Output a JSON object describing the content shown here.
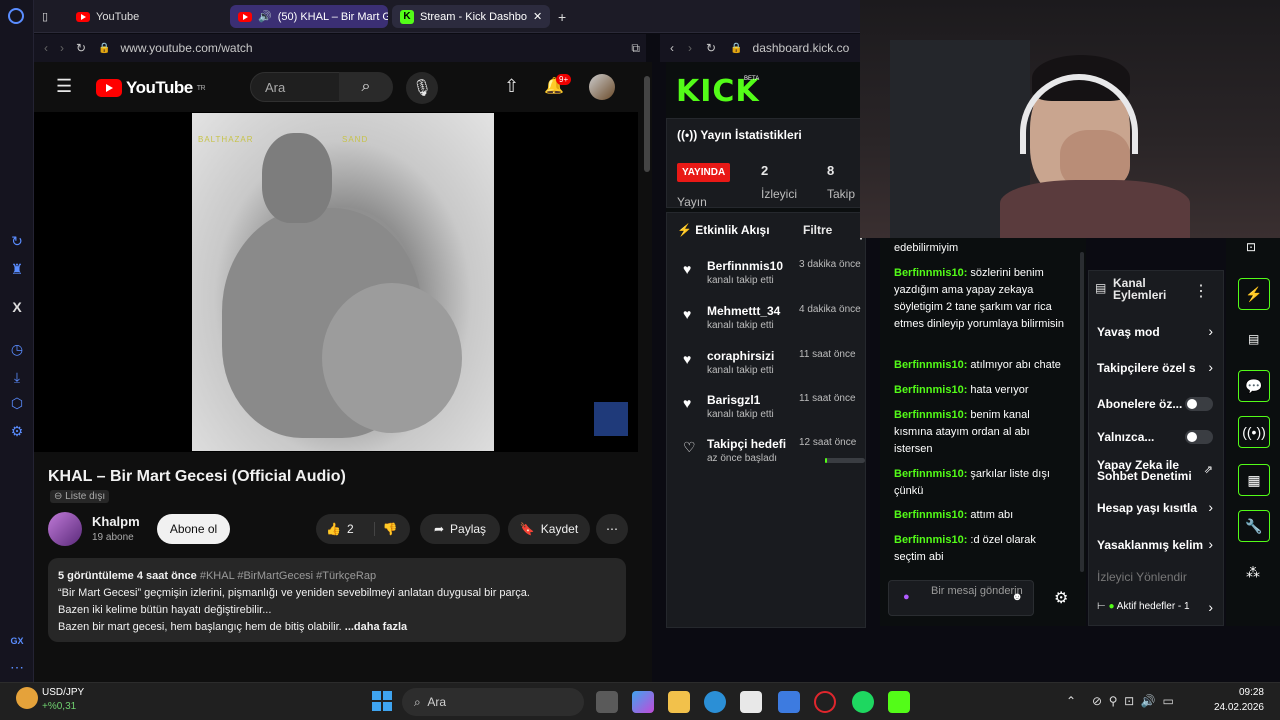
{
  "tabs": [
    {
      "label": "YouTube"
    },
    {
      "label": "(50) KHAL – Bir Mart G"
    },
    {
      "label": "Stream - Kick Dashbo"
    }
  ],
  "address_left": {
    "url": "www.youtube.com/watch"
  },
  "address_right": {
    "url": "dashboard.kick.co"
  },
  "youtube": {
    "logo": "YouTube",
    "region": "TR",
    "search_placeholder": "Ara",
    "notif_count": "9+",
    "video_overlay_left": "BALTHAZAR",
    "video_overlay_right": "SAND",
    "title": "KHAL – Bir Mart Gecesi (Official Audio)",
    "unlisted": "Liste dışı",
    "channel_name": "Khalpm",
    "channel_subs": "19 abone",
    "subscribe": "Abone ol",
    "likes": "2",
    "share": "Paylaş",
    "save": "Kaydet",
    "desc_meta": "5 görüntüleme  4 saat önce",
    "desc_tags": "#KHAL #BirMartGecesi #TürkçeRap",
    "desc_line1": "“Bir Mart Gecesi” geçmişin izlerini, pişmanlığı ve yeniden sevebilmeyi anlatan duygusal bir parça.",
    "desc_line2": "Bazen iki kelime bütün hayatı değiştirebilir...",
    "desc_line3": "Bazen bir mart gecesi, hem başlangıç hem de bitiş olabilir.",
    "desc_more": "...daha fazla"
  },
  "kick": {
    "logo": "KICK",
    "beta": "BETA",
    "stats_title": "Yayın İstatistikleri",
    "live_badge": "YAYINDA",
    "stat_viewers_value": "2",
    "stat_viewers_label": "İzleyici",
    "stat_followers_value": "8",
    "stat_followers_label": "Takip",
    "stat_stream_label": "Yayın",
    "feed_title": "Etkinlik Akışı",
    "feed_filter": "Filtre",
    "feed": [
      {
        "name": "Berfinnmis10",
        "sub": "kanalı takip etti",
        "time": "3 dakika önce"
      },
      {
        "name": "Mehmettt_34",
        "sub": "kanalı takip etti",
        "time": "4 dakika önce"
      },
      {
        "name": "coraphirsizi",
        "sub": "kanalı takip etti",
        "time": "11 saat önce"
      },
      {
        "name": "Barisgzl1",
        "sub": "kanalı takip etti",
        "time": "11 saat önce"
      },
      {
        "name": "Takipçi hedefi",
        "sub": "az önce başladı",
        "time": "12 saat önce"
      }
    ],
    "goal_progress": 0.05
  },
  "chat": {
    "messages": [
      {
        "user": "",
        "text": "edebilirmiyim"
      },
      {
        "user": "Berfinnmis10:",
        "text": " sözlerini benim yazdığım ama yapay zekaya söyletigim 2 tane şarkım var rica etmes dinleyip yorumlaya bilirmisin"
      },
      {
        "user": "Berfinnmis10:",
        "text": " atılmıyor abı chate"
      },
      {
        "user": "Berfinnmis10:",
        "text": " hata verıyor"
      },
      {
        "user": "Berfinnmis10:",
        "text": " benim kanal kısmına atayım ordan al abı istersen"
      },
      {
        "user": "Berfinnmis10:",
        "text": " şarkılar liste dışı çünkü"
      },
      {
        "user": "Berfinnmis10:",
        "text": " attım abı"
      },
      {
        "user": "Berfinnmis10:",
        "text": " :d özel olarak seçtim abi"
      }
    ],
    "input_placeholder": "Bir mesaj gönderin"
  },
  "channel_actions": {
    "title": "Kanal Eylemleri",
    "items": [
      {
        "label": "Yavaş mod",
        "kind": "chevron"
      },
      {
        "label": "Takipçilere özel s",
        "kind": "chevron"
      },
      {
        "label": "Abonelere öz...",
        "kind": "toggle"
      },
      {
        "label": "Yalnızca...",
        "kind": "toggle"
      },
      {
        "label": "Yapay Zeka ile Sohbet Denetimi",
        "kind": "external"
      },
      {
        "label": "Hesap yaşı kısıtla",
        "kind": "chevron"
      },
      {
        "label": "Yasaklanmış kelim",
        "kind": "chevron"
      },
      {
        "label": "İzleyici Yönlendir",
        "kind": "disabled"
      },
      {
        "label": "Aktif hedefler - 1",
        "kind": "chevron"
      }
    ]
  },
  "taskbar": {
    "ticker_symbol": "USD/JPY",
    "ticker_change": "+%0,31",
    "search_placeholder": "Ara",
    "time": "09:28",
    "date": "24.02.2026"
  },
  "colors": {
    "kick_green": "#53fc18",
    "yt_red": "#ff0000",
    "live_red": "#e91916",
    "tab_active": "#3b2f74"
  }
}
